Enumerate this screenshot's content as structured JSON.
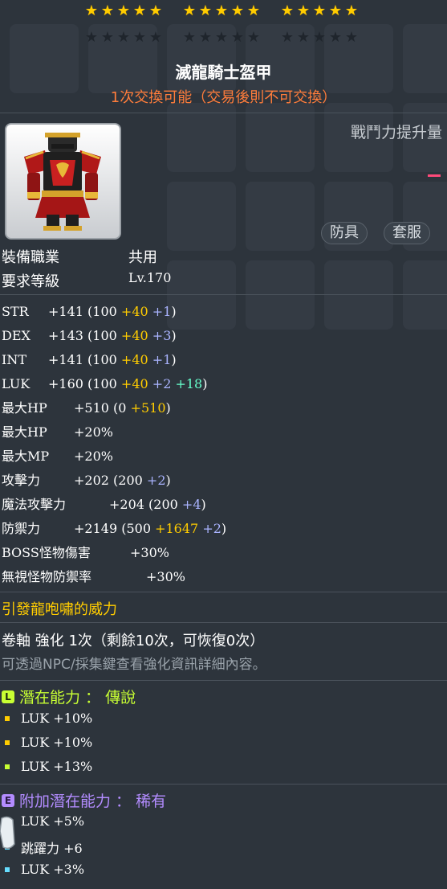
{
  "colors": {
    "background": "#2d343c",
    "star_on": "#ffcc00",
    "trade_note": "#ff7d3b",
    "flame": "#ffcc00",
    "legendary": "#c8ff33",
    "rare": "#66ddff",
    "epic_badge": "#b38cff",
    "bonus_blue": "#aab4ff",
    "bonus_green": "#66ffcc"
  },
  "stars": {
    "filled": 15,
    "total": 30
  },
  "item": {
    "name": "滅龍騎士盔甲",
    "trade_note": "1次交換可能（交易後則不可交換）",
    "combat_power_label": "戰鬥力提升量",
    "category": "防具",
    "subcategory": "套服"
  },
  "requirements": {
    "job_label": "裝備職業",
    "job_value": "共用",
    "level_label": "要求等級",
    "level_value": "Lv.170"
  },
  "stats": [
    {
      "label": "STR",
      "total": "+141",
      "base": "100",
      "flame": "+40",
      "scroll": "+1",
      "extra": ""
    },
    {
      "label": "DEX",
      "total": "+143",
      "base": "100",
      "flame": "+40",
      "scroll": "+3",
      "extra": ""
    },
    {
      "label": "INT",
      "total": "+141",
      "base": "100",
      "flame": "+40",
      "scroll": "+1",
      "extra": ""
    },
    {
      "label": "LUK",
      "total": "+160",
      "base": "100",
      "flame": "+40",
      "scroll": "+2",
      "extra": "+18"
    }
  ],
  "stats2": {
    "maxhp_flat": {
      "label": "最大HP",
      "total": "+510",
      "base": "0",
      "flame": "+510"
    },
    "maxhp_pct": {
      "label": "最大HP",
      "value": "+20%"
    },
    "maxmp_pct": {
      "label": "最大MP",
      "value": "+20%"
    },
    "att": {
      "label": "攻擊力",
      "total": "+202",
      "base": "200",
      "scroll": "+2"
    },
    "matt": {
      "label": "魔法攻擊力",
      "total": "+204",
      "base": "200",
      "scroll": "+4"
    },
    "def": {
      "label": "防禦力",
      "total": "+2149",
      "base": "500",
      "flame": "+1647",
      "scroll": "+2"
    },
    "boss": {
      "label": "BOSS怪物傷害",
      "value": "+30%"
    },
    "ied": {
      "label": "無視怪物防禦率",
      "value": "+30%"
    }
  },
  "flame_title": "引發龍咆嘯的威力",
  "scroll_line": "卷軸 強化 1次（剩餘10次，可恢復0次）",
  "hint_line": "可透過NPC/採集鍵查看強化資訊詳細內容。",
  "potential": {
    "badge": "L",
    "title": "潛在能力 ： 傳說",
    "lines": [
      "LUK +10%",
      "LUK +10%",
      "LUK +13%"
    ]
  },
  "bonus_potential": {
    "badge": "E",
    "title": "附加潛在能力 ： 稀有",
    "lines": [
      "LUK +5%",
      "跳躍力 +6",
      "LUK +3%"
    ]
  }
}
